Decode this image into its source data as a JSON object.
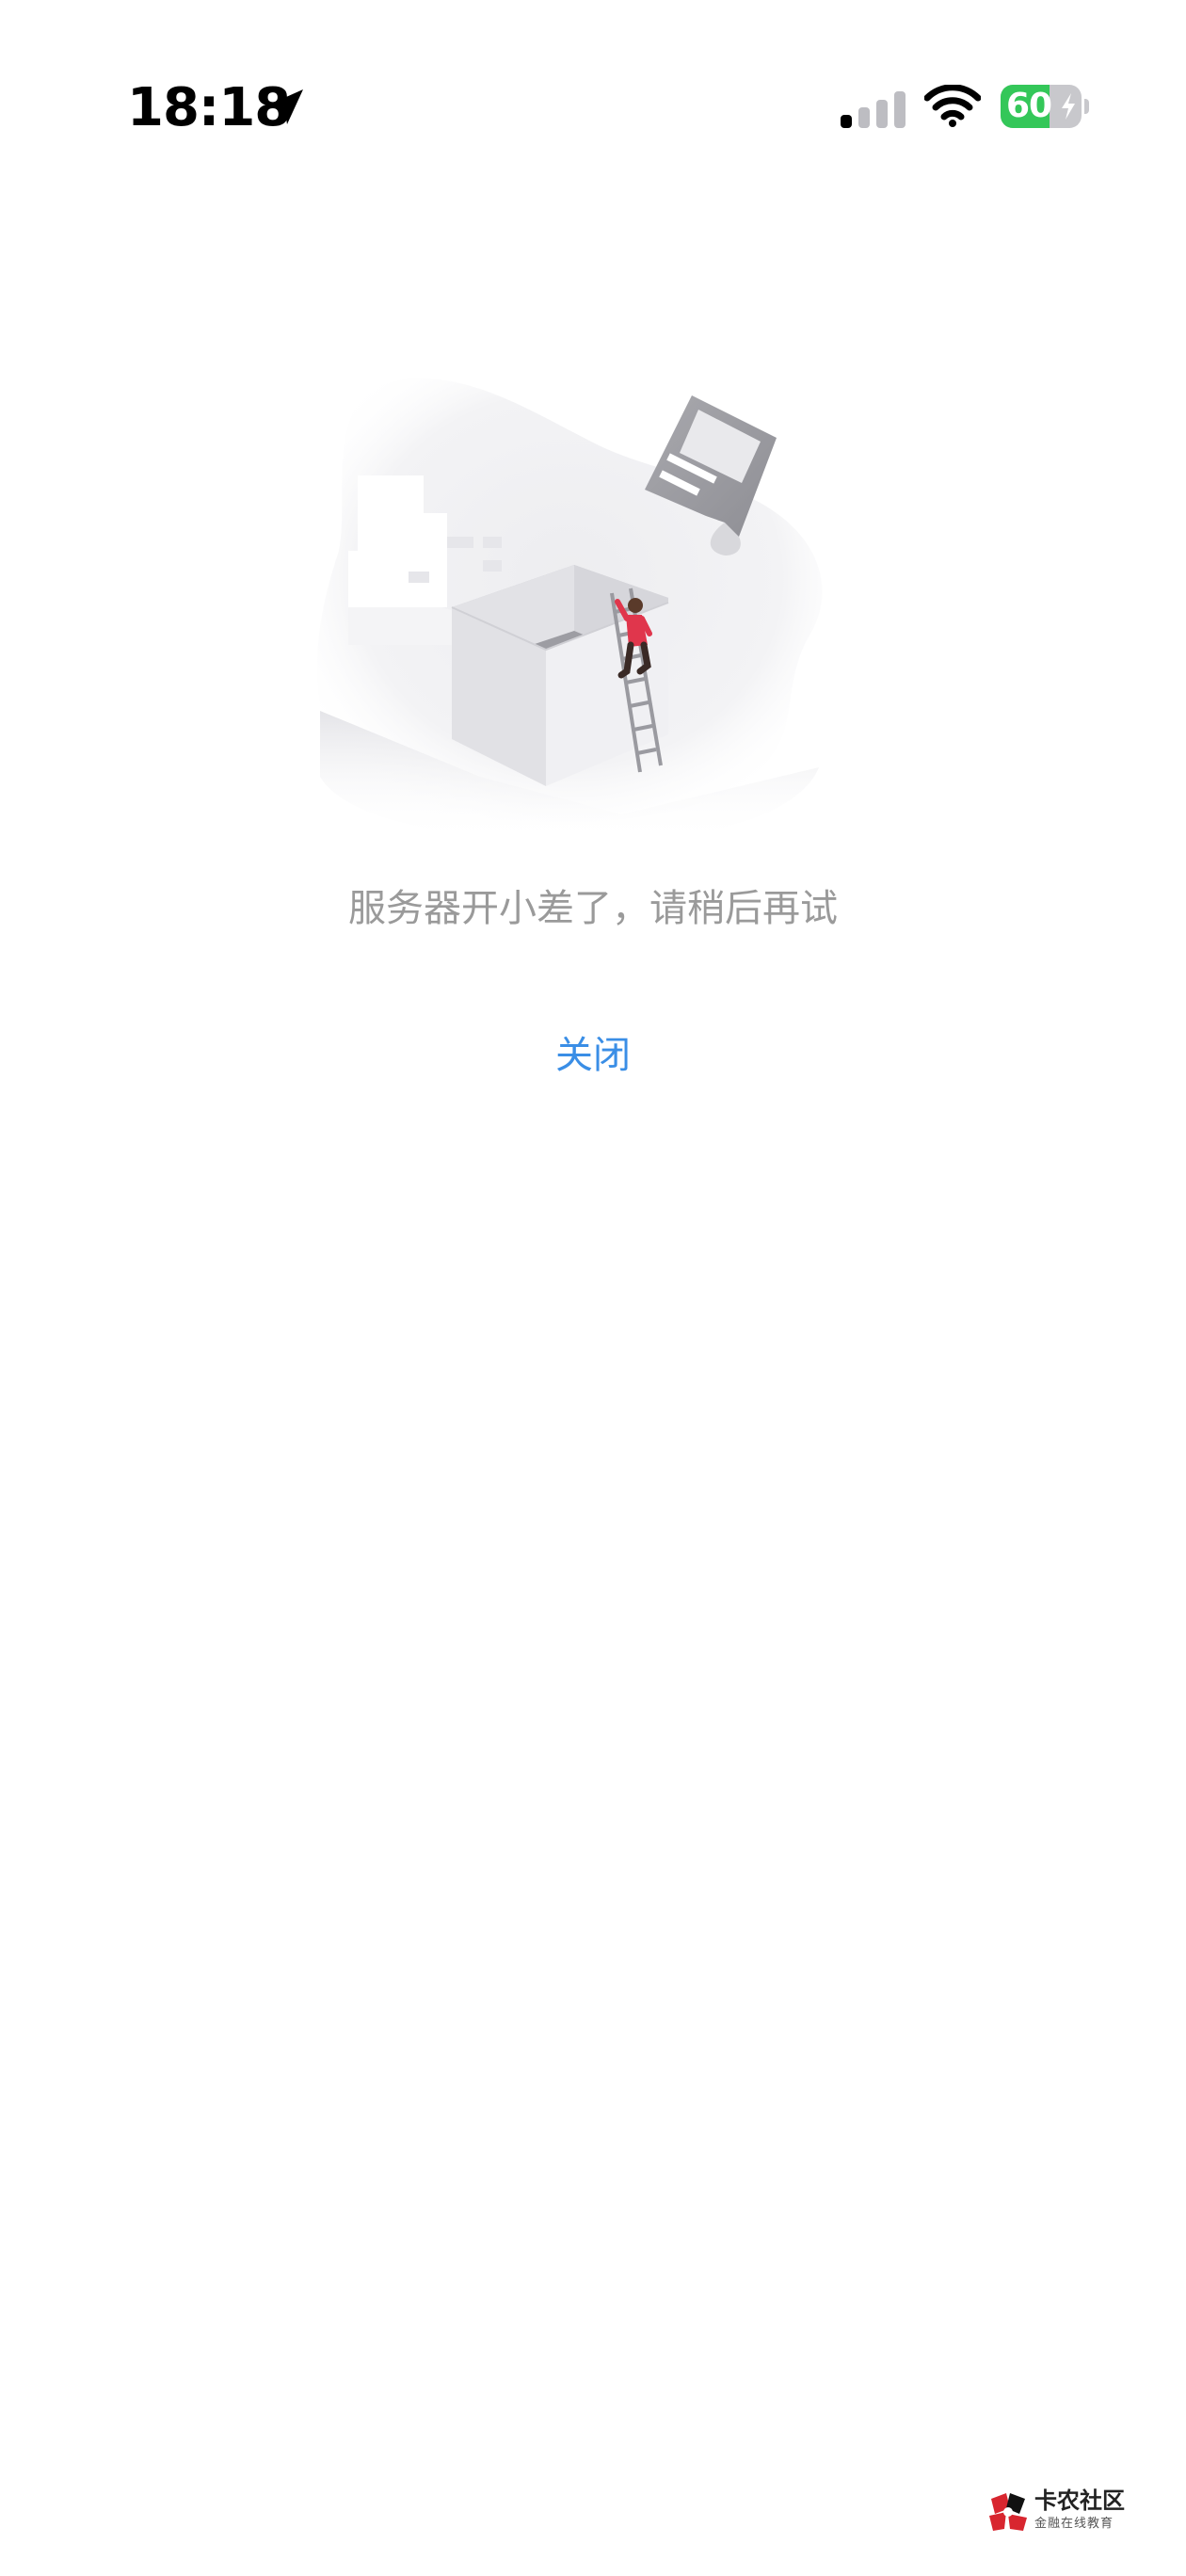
{
  "status_bar": {
    "time": "18:18",
    "battery_level": "60",
    "battery_percent": 60,
    "battery_charging": true,
    "icons": [
      "location-arrow-icon",
      "cellular-signal-icon",
      "wifi-icon",
      "battery-icon",
      "charging-bolt-icon"
    ]
  },
  "error_page": {
    "illustration": "server-error-illustration",
    "message": "服务器开小差了，请稍后再试",
    "close_label": "关闭"
  },
  "watermark": {
    "title": "卡农社区",
    "subtitle": "金融在线教育"
  },
  "colors": {
    "accent": "#3a8ee6",
    "message_text": "#9a9a9a",
    "battery_green": "#34c759",
    "figure_red": "#e0364c"
  }
}
